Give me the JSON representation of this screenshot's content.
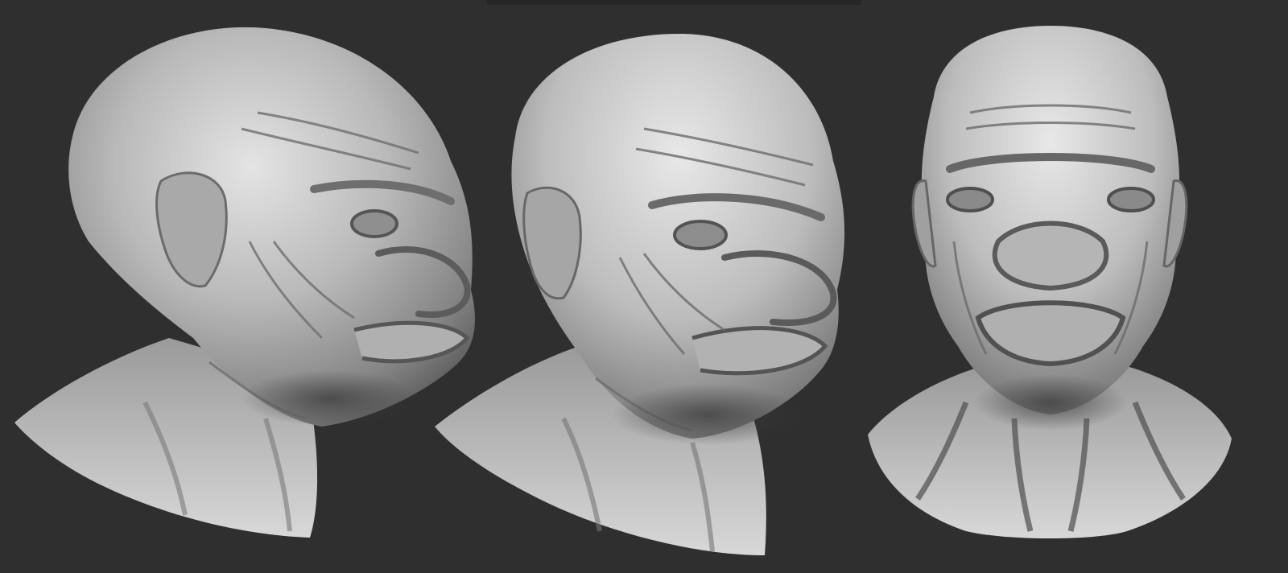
{
  "scene": {
    "background_color": "#2f2f2f",
    "material": "grey clay",
    "views": [
      {
        "id": "three-quarter-left",
        "description_icon": "sculpt-head-icon"
      },
      {
        "id": "three-quarter-center",
        "description_icon": "sculpt-head-icon"
      },
      {
        "id": "front",
        "description_icon": "sculpt-head-icon"
      }
    ]
  }
}
